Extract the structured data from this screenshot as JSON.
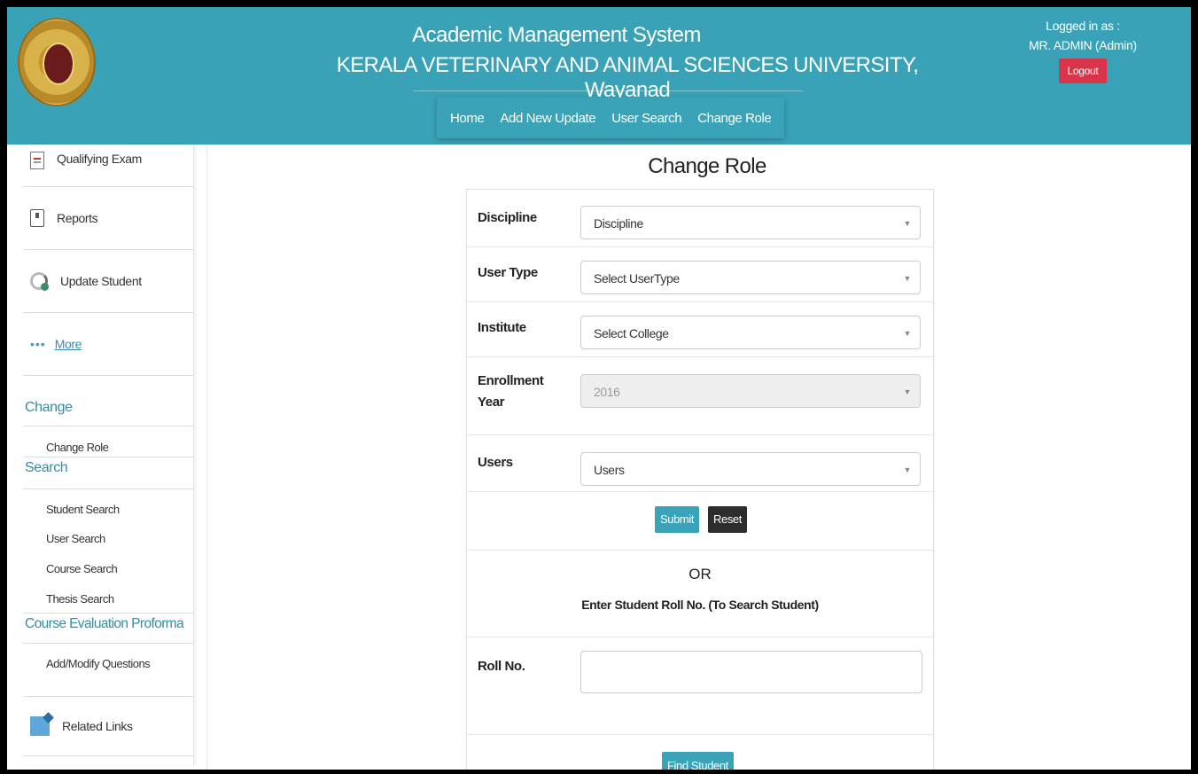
{
  "header": {
    "title_line1": "Academic Management System",
    "title_line2": "KERALA VETERINARY AND ANIMAL SCIENCES UNIVERSITY, Wayanad",
    "nav": [
      "Home",
      "Add New Update",
      "User Search",
      "Change Role"
    ],
    "logged_in_label": "Logged in as :",
    "user": "MR. ADMIN (Admin)",
    "logout_label": "Logout"
  },
  "sidebar": {
    "menu": [
      {
        "label": "Qualifying Exam",
        "icon": "document-icon"
      },
      {
        "label": "Reports",
        "icon": "report-icon"
      },
      {
        "label": "Update Student",
        "icon": "update-icon"
      },
      {
        "label": "More",
        "icon": "more-dots-icon"
      }
    ],
    "sections": {
      "change": {
        "title": "Change",
        "items": [
          "Change Role"
        ]
      },
      "search": {
        "title": "Search",
        "items": [
          "Student Search",
          "User Search",
          "Course Search",
          "Thesis Search"
        ]
      },
      "course_eval": {
        "title": "Course Evaluation Proforma",
        "items": [
          "Add/Modify Questions"
        ]
      }
    },
    "related_links": "Related Links"
  },
  "main": {
    "title": "Change Role",
    "fields": {
      "discipline": {
        "label": "Discipline",
        "value": "Discipline"
      },
      "user_type": {
        "label": "User Type",
        "value": "Select UserType"
      },
      "institute": {
        "label": "Institute",
        "value": "Select College"
      },
      "enrollment_year": {
        "label_line1": "Enrollment",
        "label_line2": "Year",
        "value": "2016"
      },
      "users": {
        "label": "Users",
        "value": "Users"
      }
    },
    "submit_label": "Submit",
    "reset_label": "Reset",
    "or_text": "OR",
    "enter_text": "Enter Student Roll No. (To Search Student)",
    "roll_no_label": "Roll No.",
    "roll_no_value": "",
    "find_student_label": "Find Student"
  },
  "colors": {
    "header_bg": "#39a2b6",
    "logout_bg": "#d9354a",
    "submit_bg": "#3aa3b7",
    "reset_bg": "#2d2d2d",
    "section_text": "#2f8fa3"
  }
}
